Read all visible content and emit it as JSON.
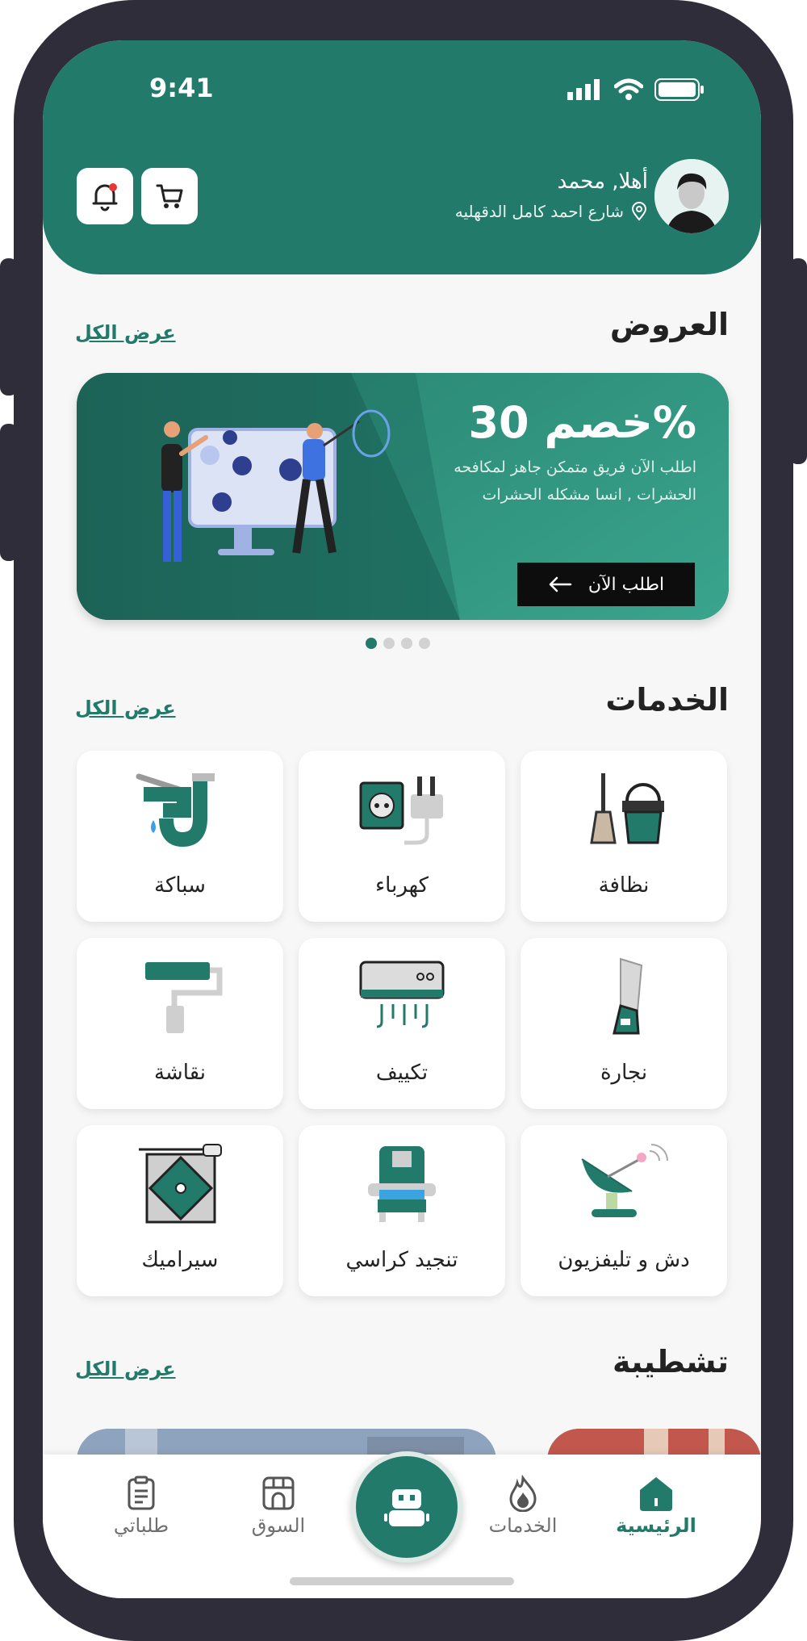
{
  "status": {
    "time": "9:41"
  },
  "header": {
    "greeting": "أهلا, محمد",
    "address": "شارع احمد كامل الدقهليه"
  },
  "offers": {
    "title": "العروض",
    "see_all": "عرض الكل",
    "banner": {
      "headline": "خصم 30%",
      "text": "اطلب الآن فريق متمكن جاهز لمكافحه الحشرات , انسا مشكله الحشرات",
      "button": "اطلب الآن"
    },
    "dots": 4,
    "active_dot": 0
  },
  "services": {
    "title": "الخدمات",
    "see_all": "عرض الكل",
    "items": [
      {
        "label": "نظافة",
        "icon": "cleaning-icon"
      },
      {
        "label": "كهرباء",
        "icon": "electricity-icon"
      },
      {
        "label": "سباكة",
        "icon": "plumbing-icon"
      },
      {
        "label": "نجارة",
        "icon": "carpentry-icon"
      },
      {
        "label": "تكييف",
        "icon": "air-conditioning-icon"
      },
      {
        "label": "نقاشة",
        "icon": "painting-icon"
      },
      {
        "label": "دش و تليفزيون",
        "icon": "satellite-dish-icon"
      },
      {
        "label": "تنجيد كراسي",
        "icon": "upholstery-icon"
      },
      {
        "label": "سيراميك",
        "icon": "ceramic-tile-icon"
      }
    ]
  },
  "finishing": {
    "title": "تشطيبة",
    "see_all": "عرض الكل"
  },
  "nav": [
    {
      "label": "الرئيسية",
      "icon": "home-icon",
      "active": true
    },
    {
      "label": "الخدمات",
      "icon": "services-icon",
      "active": false
    },
    {
      "label": "السوق",
      "icon": "market-icon",
      "active": false
    },
    {
      "label": "طلباتي",
      "icon": "orders-icon",
      "active": false
    }
  ],
  "colors": {
    "primary": "#227a6b",
    "frame": "#2f2d3a",
    "background": "#f7f7f7"
  }
}
